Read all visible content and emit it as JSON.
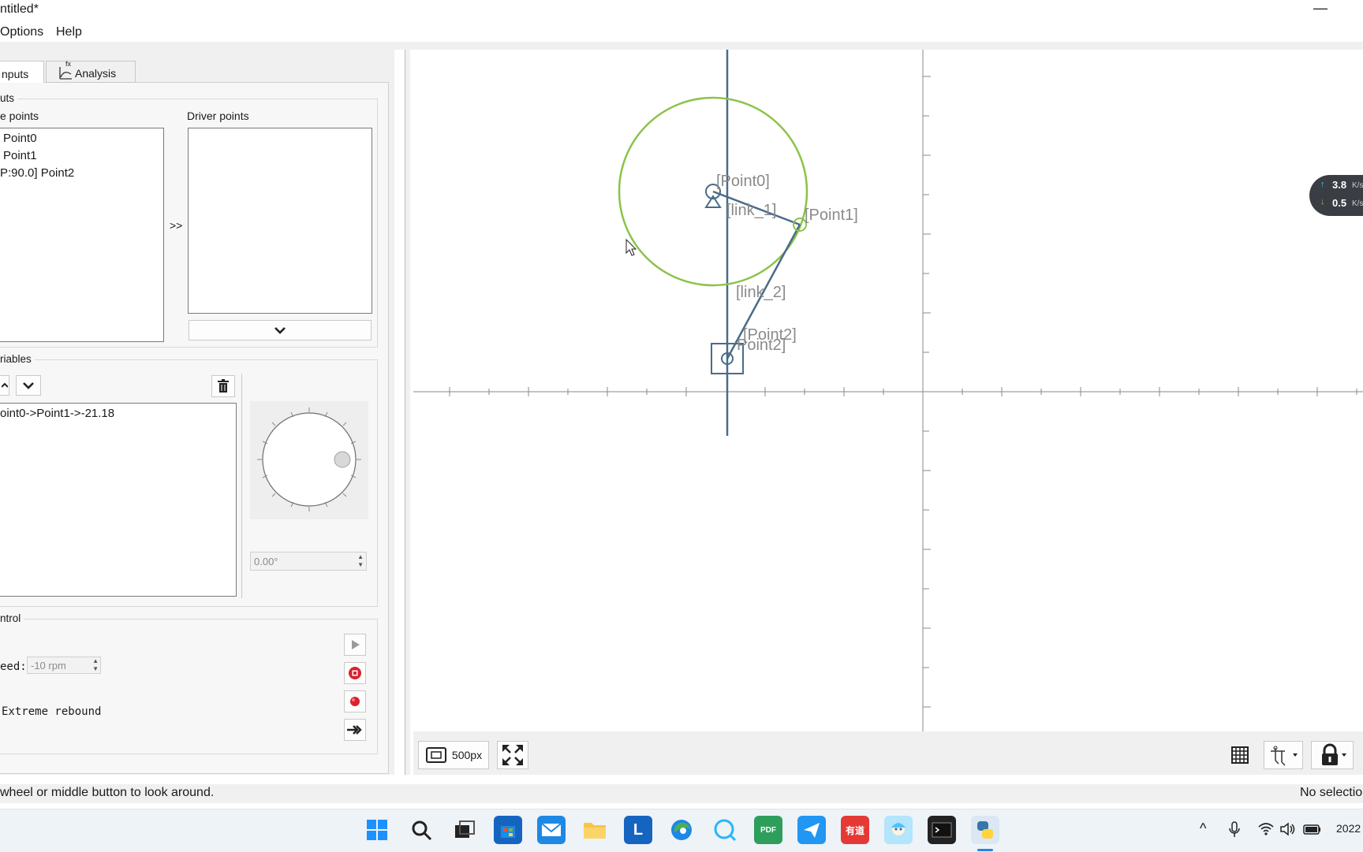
{
  "window": {
    "title": "ntitled*",
    "minimize_glyph": "—"
  },
  "menu": {
    "items": [
      "Options",
      "Help"
    ]
  },
  "tabs": {
    "inputs": "nputs",
    "analysis": "Analysis",
    "analysis_icon_text": "fx"
  },
  "inputs_group": {
    "title": "uts",
    "left_label": "e points",
    "right_label": "Driver points",
    "left_items": [
      "Point0",
      "Point1",
      "P:90.0] Point2"
    ],
    "transfer_glyph": ">>"
  },
  "variables_group": {
    "title": "riables",
    "items": [
      "oint0->Point1->-21.18"
    ],
    "angle_value": "0.00°"
  },
  "control_group": {
    "title": "ntrol",
    "speed_label": "eed:",
    "speed_value": "-10 rpm",
    "rebound_label": "Extreme rebound"
  },
  "canvas": {
    "labels": [
      "[Point0]",
      "[link_1]",
      "[Point1]",
      "[link_2]",
      "[Point2]",
      "Point2]"
    ],
    "zoom_label": "500px"
  },
  "status": {
    "left": "wheel or middle button to look around.",
    "right": "No selectio"
  },
  "netspeed": {
    "up": "3.8",
    "up_unit": "K/s",
    "down": "0.5",
    "down_unit": "K/s"
  },
  "taskbar": {
    "pdf_label": "PDF",
    "youdao_label": "有道",
    "clock": "2022"
  },
  "colors": {
    "link": "#4a6b8a",
    "circle": "#8bc34a",
    "label": "#8a8a8a"
  }
}
